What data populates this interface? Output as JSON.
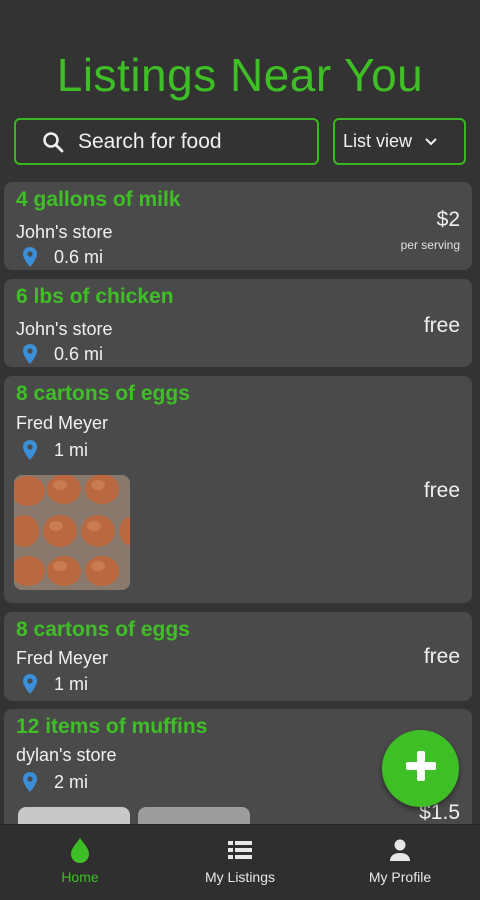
{
  "header": {
    "title": "Listings Near You"
  },
  "search": {
    "placeholder": "Search for food"
  },
  "view_select": {
    "selected": "List view"
  },
  "listings": [
    {
      "name": "4 gallons of milk",
      "store": "John's store",
      "distance": "0.6 mi",
      "price": "$2",
      "price_note": "per serving"
    },
    {
      "name": "6 lbs of chicken",
      "store": "John's store",
      "distance": "0.6 mi",
      "price": "free"
    },
    {
      "name": "8 cartons of eggs",
      "store": "Fred Meyer",
      "distance": "1 mi",
      "price": "free"
    },
    {
      "name": "8 cartons of eggs",
      "store": "Fred Meyer",
      "distance": "1 mi",
      "price": "free"
    },
    {
      "name": "12 items of muffins",
      "store": "dylan's store",
      "distance": "2 mi",
      "price": "$1.5"
    }
  ],
  "fab": {
    "icon": "plus-icon"
  },
  "bottom_nav": {
    "items": [
      {
        "label": "Home",
        "icon": "drop-icon",
        "active": true
      },
      {
        "label": "My Listings",
        "icon": "list-icon",
        "active": false
      },
      {
        "label": "My Profile",
        "icon": "person-icon",
        "active": false
      }
    ]
  },
  "colors": {
    "accent": "#3fbf26",
    "background": "#333333",
    "card": "#4a4a4a",
    "pin": "#3a8fd8"
  }
}
